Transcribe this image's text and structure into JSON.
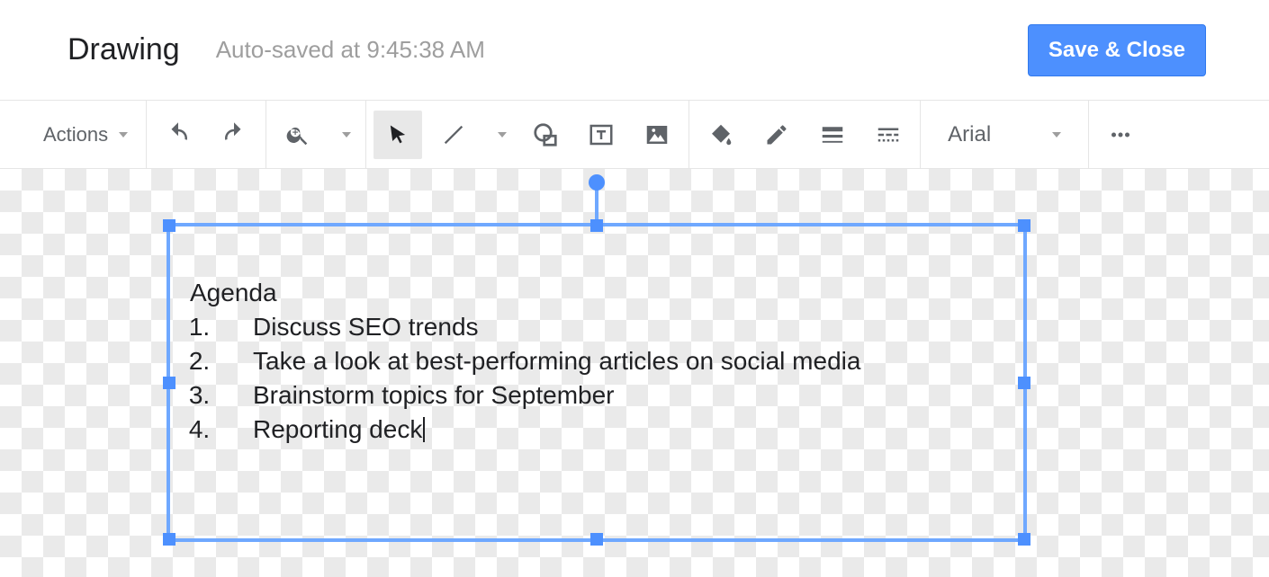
{
  "header": {
    "title": "Drawing",
    "autosave": "Auto-saved at 9:45:38 AM",
    "save_close": "Save & Close"
  },
  "toolbar": {
    "actions_label": "Actions",
    "font_label": "Arial"
  },
  "textbox": {
    "heading": "Agenda",
    "items": [
      "Discuss SEO trends",
      "Take a look at best-performing articles on social media",
      "Brainstorm topics for September",
      "Reporting deck"
    ]
  }
}
